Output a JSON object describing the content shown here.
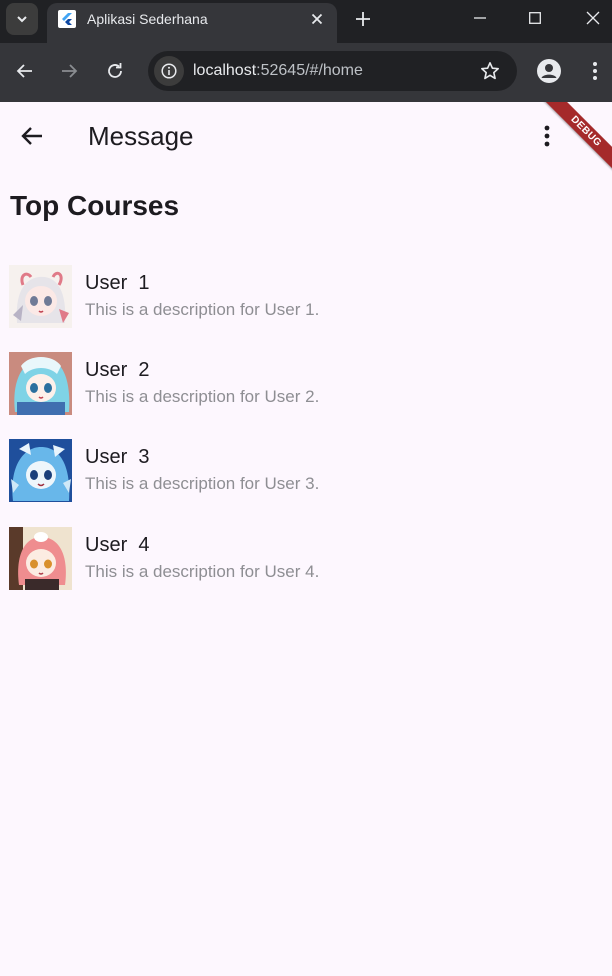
{
  "browser": {
    "tab_title": "Aplikasi Sederhana",
    "url_host": "localhost",
    "url_rest": ":52645/#/home"
  },
  "appbar": {
    "title": "Message",
    "debug_label": "DEBUG"
  },
  "section": {
    "heading": "Top Courses"
  },
  "items": [
    {
      "name": "User  1",
      "description": "This is a description for User 1."
    },
    {
      "name": "User  2",
      "description": "This is a description for User 2."
    },
    {
      "name": "User  3",
      "description": "This is a description for User 3."
    },
    {
      "name": "User  4",
      "description": "This is a description for User 4."
    }
  ],
  "colors": {
    "app_background": "#fdf7fe",
    "debug_banner": "#a52a2a",
    "text_primary": "#1d1b20",
    "text_secondary": "#8e8e93",
    "browser_dark": "#202124"
  }
}
